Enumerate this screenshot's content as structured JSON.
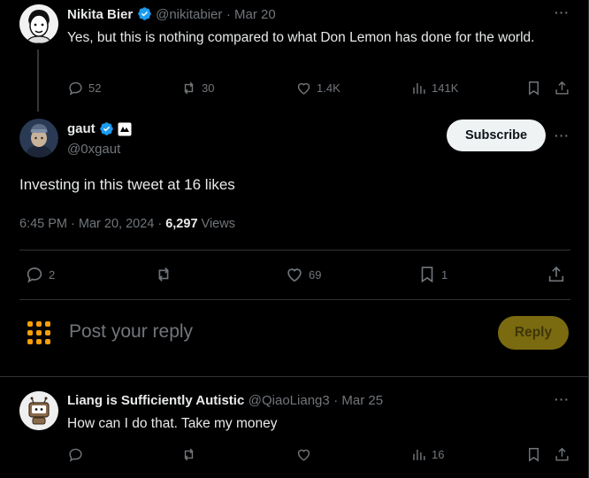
{
  "tweet1": {
    "name": "Nikita Bier",
    "handle": "@nikitabier",
    "date": "· Mar 20",
    "text": "Yes, but this is nothing compared to what Don Lemon has done for the world.",
    "replies": "52",
    "retweets": "30",
    "likes": "1.4K",
    "views": "141K"
  },
  "main_tweet": {
    "name": "gaut",
    "handle": "@0xgaut",
    "subscribe_label": "Subscribe",
    "text": "Investing in this tweet at 16 likes",
    "timestamp": "6:45 PM · Mar 20, 2024 ·",
    "views_count": "6,297",
    "views_label": "Views",
    "replies": "2",
    "likes": "69",
    "bookmarks": "1"
  },
  "compose": {
    "placeholder": "Post your reply",
    "reply_label": "Reply"
  },
  "tweet2": {
    "name": "Liang is Sufficiently Autistic",
    "handle": "@QiaoLiang3",
    "date": "· Mar 25",
    "text": "How can I do that. Take my money",
    "views": "16"
  },
  "colors": {
    "verified_blue": "#1d9bf0",
    "reply_button": "#7a6a10",
    "compose_icon": "#f59e0b"
  },
  "icons": [
    "verified-badge-icon",
    "more-icon",
    "reply-icon",
    "retweet-icon",
    "like-icon",
    "views-icon",
    "bookmark-icon",
    "share-icon",
    "affiliate-badge-icon",
    "compose-grid-icon"
  ]
}
